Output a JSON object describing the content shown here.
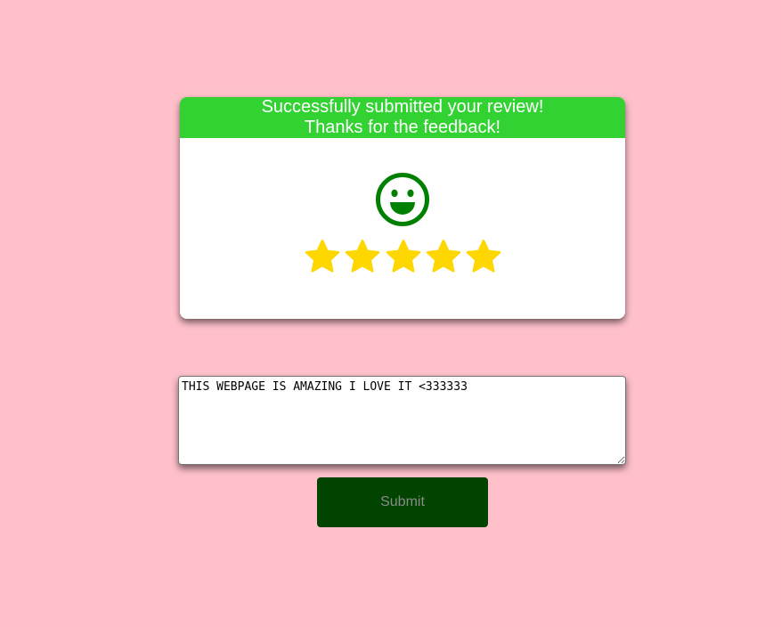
{
  "feedback_card": {
    "message_line1": "Successfully submitted your review!",
    "message_line2": "Thanks for the feedback!",
    "face_icon": "smiling-face-icon",
    "rating": 5,
    "rating_max": 5,
    "star_icon": "star-icon"
  },
  "review": {
    "value": "THIS WEBPAGE IS AMAZING I LOVE IT <333333"
  },
  "submit_label": "Submit",
  "colors": {
    "background": "#ffc0cb",
    "banner": "#32d232",
    "face": "#008000",
    "star": "#ffd700",
    "submit_button": "#004400",
    "submit_text": "#8a8a8a"
  }
}
